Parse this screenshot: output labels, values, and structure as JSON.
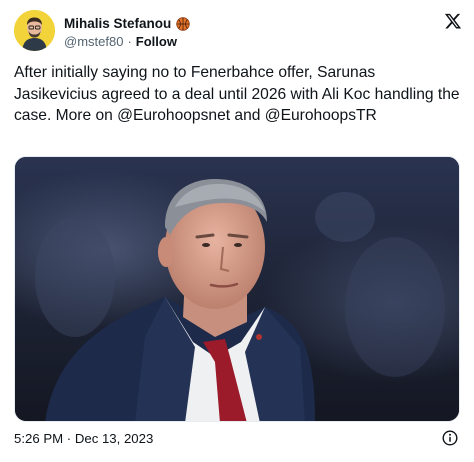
{
  "author": {
    "name": "Mihalis Stefanou",
    "badge_icon": "basketball-icon",
    "handle": "@mstef80",
    "separator": "·",
    "follow_label": "Follow"
  },
  "platform_icon": "x-logo-icon",
  "tweet": {
    "text": "After initially saying no to Fenerbahce offer, Sarunas Jasikevicius agreed to a deal until 2026 with Ali Koc handling the case. More on @Eurohoopsnet and @EurohoopsTR"
  },
  "footer": {
    "timestamp": "5:26 PM · Dec 13, 2023",
    "info_icon": "info-icon"
  },
  "colors": {
    "accent_yellow": "#f2d43a",
    "text_primary": "#0f1419",
    "text_secondary": "#536471",
    "badge_orange": "#e8742a"
  }
}
